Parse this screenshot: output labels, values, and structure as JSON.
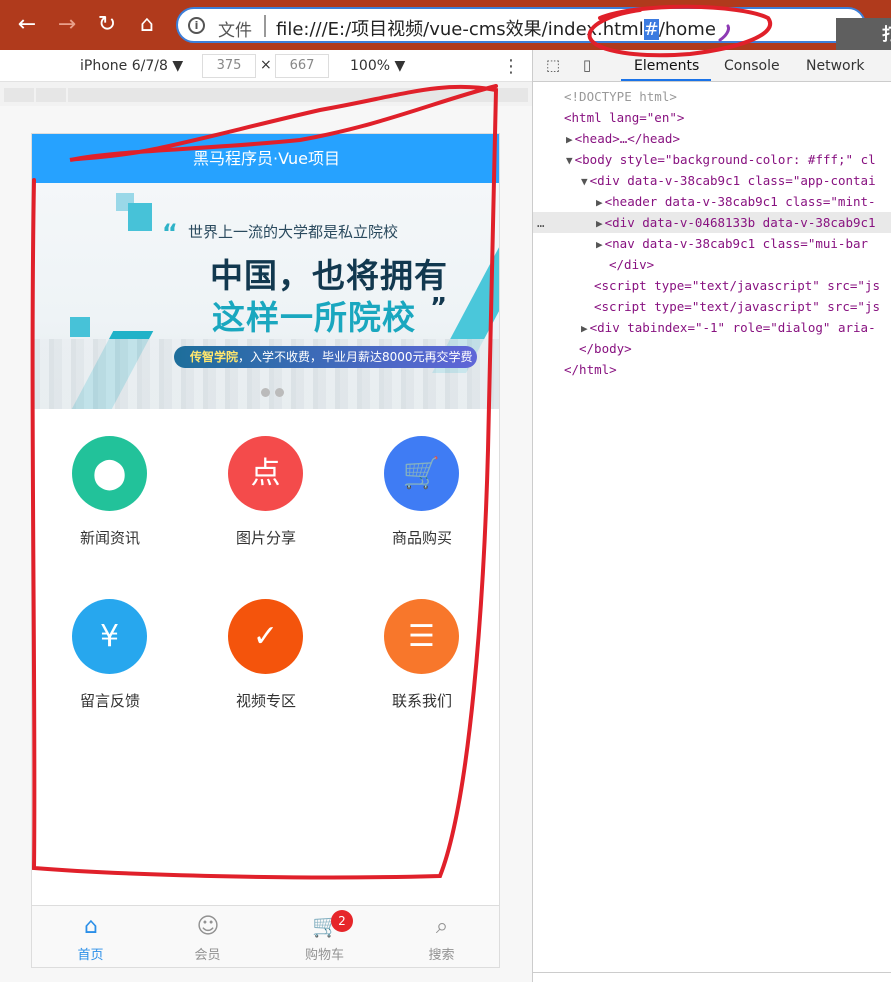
{
  "browser": {
    "back_icon": "arrow-left-icon",
    "forward_icon": "arrow-right-icon",
    "reload_icon": "reload-icon",
    "home_icon": "home-icon",
    "site_info_icon": "info-icon",
    "file_label": "文件",
    "url_prefix": "file:///E:/项目视频/vue-cms效果/index.html",
    "url_hash": "#",
    "url_suffix": "/home"
  },
  "device_toolbar": {
    "device": "iPhone 6/7/8 ▼",
    "width": "375",
    "times": "×",
    "height": "667",
    "zoom": "100% ▼",
    "more_icon": "kebab-menu-icon"
  },
  "app": {
    "header_title": "黑马程序员·Vue项目",
    "banner": {
      "tagline": "世界上一流的大学都是私立院校",
      "line1": "中国，也将拥有",
      "line2": "这样一所院校",
      "pill_bold": "传智学院",
      "pill_text": "，入学不收费，毕业月薪达8000元再交学费",
      "slides": 2,
      "active_slide": 1
    },
    "grid": [
      {
        "label": "新闻资讯",
        "icon": "location-pin-icon",
        "color": "#22c29a"
      },
      {
        "label": "图片分享",
        "icon": "photo-share-icon",
        "color": "#f44b4b"
      },
      {
        "label": "商品购买",
        "icon": "shopping-cart-icon",
        "color": "#3f7cf4"
      },
      {
        "label": "留言反馈",
        "icon": "phone-yen-icon",
        "color": "#27a7ee"
      },
      {
        "label": "视频专区",
        "icon": "video-check-icon",
        "color": "#f4540c"
      },
      {
        "label": "联系我们",
        "icon": "list-icon",
        "color": "#f8772b"
      }
    ],
    "tabbar": [
      {
        "label": "首页",
        "icon": "home-icon",
        "active": true
      },
      {
        "label": "会员",
        "icon": "user-icon",
        "active": false
      },
      {
        "label": "购物车",
        "icon": "cart-icon",
        "active": false,
        "badge": "2"
      },
      {
        "label": "搜索",
        "icon": "search-icon",
        "active": false
      }
    ]
  },
  "devtools": {
    "inspect_icon": "inspect-element-icon",
    "device_icon": "device-toggle-icon",
    "tabs": [
      "Elements",
      "Console",
      "Network"
    ],
    "active_tab": "Elements",
    "lines": [
      {
        "indent": 0,
        "toggle": "",
        "text": "<!DOCTYPE html>",
        "style": "dim"
      },
      {
        "indent": 0,
        "toggle": "",
        "text": "<html lang=\"en\">"
      },
      {
        "indent": 1,
        "toggle": "▶",
        "text": "<head>…</head>"
      },
      {
        "indent": 1,
        "toggle": "▼",
        "text": "<body style=\"background-color: #fff;\" cl"
      },
      {
        "indent": 2,
        "toggle": "▼",
        "text": "<div data-v-38cab9c1 class=\"app-contai"
      },
      {
        "indent": 3,
        "toggle": "▶",
        "text": "<header data-v-38cab9c1 class=\"mint-"
      },
      {
        "indent": 3,
        "toggle": "▶",
        "text": "<div data-v-0468133b data-v-38cab9c1",
        "selected": true
      },
      {
        "indent": 3,
        "toggle": "▶",
        "text": "<nav data-v-38cab9c1 class=\"mui-bar "
      },
      {
        "indent": 3,
        "toggle": "",
        "text": "</div>"
      },
      {
        "indent": 2,
        "toggle": "",
        "text": "<script type=\"text/javascript\" src=\"js"
      },
      {
        "indent": 2,
        "toggle": "",
        "text": "<script type=\"text/javascript\" src=\"js"
      },
      {
        "indent": 2,
        "toggle": "▶",
        "text": "<div tabindex=\"-1\" role=\"dialog\" aria-"
      },
      {
        "indent": 1,
        "toggle": "",
        "text": "</body>"
      },
      {
        "indent": 0,
        "toggle": "",
        "text": "</html>"
      }
    ],
    "ellipsis": "…"
  },
  "overlay": {
    "corner_mark": "打"
  },
  "colors": {
    "browser_chrome": "#b03a1c",
    "app_header": "#26a2ff",
    "annotation": "#e0202a",
    "tab_active": "#2b8fe8"
  }
}
